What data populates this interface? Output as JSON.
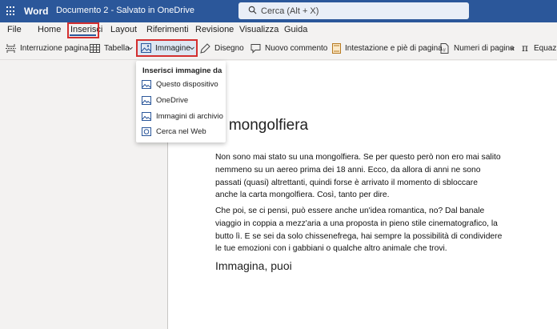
{
  "titlebar": {
    "app_name": "Word",
    "document_title": "Documento 2  -  Salvato in OneDrive",
    "search_placeholder": "Cerca (Alt + X)"
  },
  "menu": {
    "tabs": [
      "File",
      "Home",
      "Inserisci",
      "Layout",
      "Riferimenti",
      "Revisione",
      "Visualizza",
      "Guida"
    ],
    "active_tab": "Inserisci"
  },
  "ribbon": {
    "items": [
      {
        "label": "Interruzione pagina",
        "icon": "page-break-icon"
      },
      {
        "label": "Tabella",
        "icon": "table-icon"
      },
      {
        "label": "Immagine",
        "icon": "image-icon"
      },
      {
        "label": "Disegno",
        "icon": "drawing-icon"
      },
      {
        "label": "Nuovo commento",
        "icon": "comment-icon"
      },
      {
        "label": "Intestazione e piè di pagina",
        "icon": "header-footer-icon"
      },
      {
        "label": "Numeri di pagina",
        "icon": "page-number-icon"
      },
      {
        "label": "Equazio",
        "icon": "equation-icon"
      }
    ]
  },
  "dropdown": {
    "header": "Inserisci immagine da",
    "items": [
      {
        "label": "Questo dispositivo",
        "icon": "device-image-icon"
      },
      {
        "label": "OneDrive",
        "icon": "onedrive-image-icon"
      },
      {
        "label": "Immagini di archivio",
        "icon": "stock-image-icon"
      },
      {
        "label": "Cerca nel Web",
        "icon": "web-image-icon"
      }
    ]
  },
  "document": {
    "heading_visible": "a mongolfiera",
    "paragraph1_lines": [
      "Non sono mai stato su una mongolfiera. Se per questo però non ero mai salito",
      "nemmeno su un aereo prima dei 18 anni. Ecco, da allora di anni ne sono",
      "passati (quasi) altrettanti, quindi forse è arrivato il momento di sbloccare",
      "anche la carta mongolfiera. Così, tanto per dire."
    ],
    "paragraph2_lines": [
      "Che poi, se ci pensi, può essere anche un'idea romantica, no? Dal banale",
      "viaggio in coppia a mezz'aria a una proposta in pieno stile cinematografico, la",
      "butto lì. E se sei da solo chissenefrega, hai sempre la possibilità di condividere",
      "le tue emozioni con i gabbiani o qualche altro animale che trovi."
    ],
    "subheading": "Immagina, puoi"
  },
  "colors": {
    "titlebar": "#2b579a",
    "highlight": "#d32f2f"
  }
}
